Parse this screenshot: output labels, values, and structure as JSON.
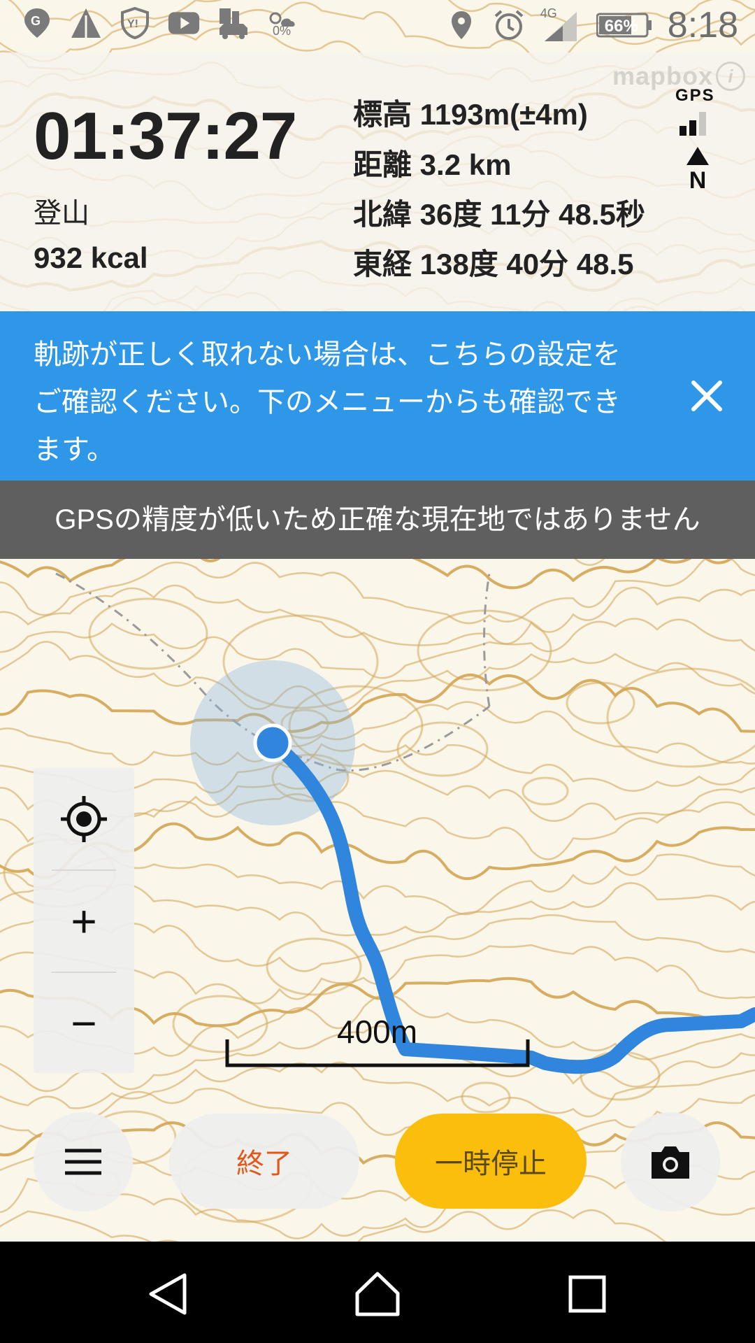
{
  "status_bar": {
    "time": "8:18",
    "battery": "66%",
    "network": "4G",
    "weather_percent": "0%",
    "icons": [
      "maps-icon",
      "triangle-app-icon",
      "yahoo-shield-icon",
      "youtube-icon",
      "car-traffic-icon",
      "weather-icon",
      "location-pin-icon",
      "alarm-icon",
      "signal-icon",
      "battery-icon"
    ]
  },
  "tracking": {
    "elapsed_time": "01:37:27",
    "activity": "登山",
    "calories": "932 kcal",
    "altitude": "標高 1193m(±4m)",
    "distance": "距離 3.2 km",
    "latitude": "北緯 36度 11分 48.5秒",
    "longitude": "東経 138度 40分 48.5"
  },
  "gps": {
    "label": "GPS",
    "signal_bars_filled": 2,
    "signal_bars_total": 3
  },
  "compass": {
    "label": "N"
  },
  "map": {
    "attribution": "mapbox",
    "info_label": "i",
    "scale_label": "400m",
    "colors": {
      "contour": "#d4a95a",
      "track": "#2f86dc",
      "paper": "#fbf6ea"
    }
  },
  "banner": {
    "message": "軌跡が正しく取れない場合は、こちらの設定をご確認ください。下のメニューからも確認できます。",
    "color": "#2f97e8"
  },
  "warning": {
    "message": "GPSの精度が低いため正確な現在地ではありません"
  },
  "controls": {
    "locate_icon": "crosshair-icon",
    "zoom_in": "+",
    "zoom_out": "−"
  },
  "actions": {
    "menu_icon": "hamburger-icon",
    "end_label": "終了",
    "pause_label": "一時停止",
    "camera_icon": "camera-icon",
    "pause_color": "#fbbe0d"
  },
  "nav": {
    "back": "back-icon",
    "home": "home-icon",
    "recents": "recents-icon"
  }
}
